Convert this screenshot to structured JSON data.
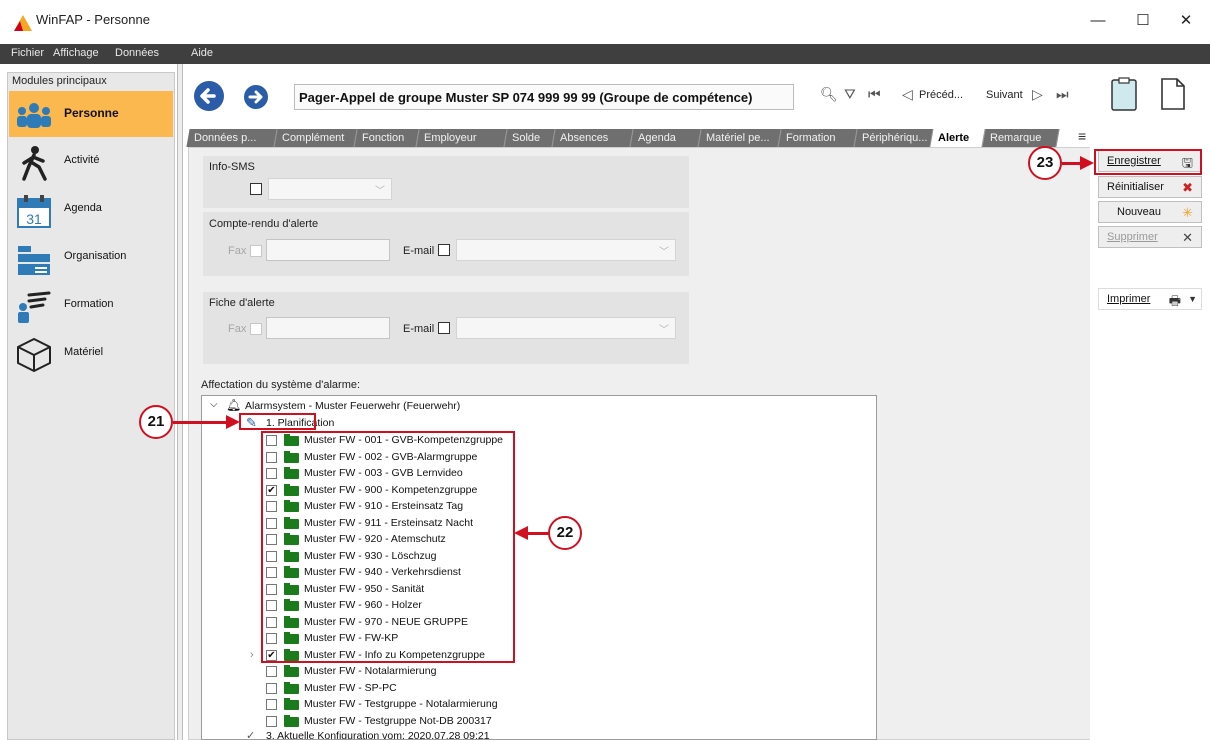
{
  "window": {
    "title": "WinFAP - Personne",
    "min": "—",
    "max": "☐",
    "close": "✕"
  },
  "menu": [
    "Fichier",
    "Affichage",
    "Données",
    "Aide"
  ],
  "sidebar": {
    "title": "Modules principaux",
    "items": [
      {
        "label": "Personne",
        "active": true,
        "icon": "people-icon"
      },
      {
        "label": "Activité",
        "icon": "walking-person-icon"
      },
      {
        "label": "Agenda",
        "icon": "calendar-icon"
      },
      {
        "label": "Organisation",
        "icon": "organization-icon"
      },
      {
        "label": "Formation",
        "icon": "presentation-icon"
      },
      {
        "label": "Matériel",
        "icon": "box-icon"
      }
    ],
    "calendar_day": "31"
  },
  "header": {
    "record_title": "Pager-Appel de groupe Muster SP 074 999 99 99 (Groupe de compétence)",
    "prev_label": "Précéd...",
    "next_label": "Suivant"
  },
  "tabs": [
    "Données p...",
    "Complément",
    "Fonction",
    "Employeur",
    "Solde",
    "Absences",
    "Agenda",
    "Matériel pe...",
    "Formation",
    "Périphériqu...",
    "Alerte",
    "Remarque"
  ],
  "active_tab": "Alerte",
  "form": {
    "info_sms_label": "Info-SMS",
    "compte_rendu_label": "Compte-rendu d'alerte",
    "fiche_label": "Fiche d'alerte",
    "fax_label": "Fax",
    "email_label": "E-mail",
    "affectation_label": "Affectation du système d'alarme:"
  },
  "tree": {
    "root": "Alarmsystem - Muster Feuerwehr (Feuerwehr)",
    "planification": "1. Planification",
    "groups": [
      {
        "label": "Muster FW - 001 - GVB-Kompetenzgruppe",
        "checked": false
      },
      {
        "label": "Muster FW - 002 - GVB-Alarmgruppe",
        "checked": false
      },
      {
        "label": "Muster FW - 003 - GVB Lernvideo",
        "checked": false
      },
      {
        "label": "Muster FW - 900 - Kompetenzgruppe",
        "checked": true
      },
      {
        "label": "Muster FW - 910 - Ersteinsatz Tag",
        "checked": false
      },
      {
        "label": "Muster FW - 911 - Ersteinsatz Nacht",
        "checked": false
      },
      {
        "label": "Muster FW - 920 - Atemschutz",
        "checked": false
      },
      {
        "label": "Muster FW - 930 - Löschzug",
        "checked": false
      },
      {
        "label": "Muster FW - 940 - Verkehrsdienst",
        "checked": false
      },
      {
        "label": "Muster FW - 950 - Sanität",
        "checked": false
      },
      {
        "label": "Muster FW - 960 - Holzer",
        "checked": false
      },
      {
        "label": "Muster FW - 970 - NEUE GRUPPE",
        "checked": false
      },
      {
        "label": "Muster FW - FW-KP",
        "checked": false
      },
      {
        "label": "Muster FW - Info zu Kompetenzgruppe",
        "checked": true
      },
      {
        "label": "Muster FW - Notalarmierung",
        "checked": false
      },
      {
        "label": "Muster FW - SP-PC",
        "checked": false
      },
      {
        "label": "Muster FW - Testgruppe - Notalarmierung",
        "checked": false
      },
      {
        "label": "Muster FW - Testgruppe Not-DB 200317",
        "checked": false
      }
    ],
    "config": "3. Aktuelle Konfiguration vom: 2020.07.28 09:21"
  },
  "actions": {
    "save": "Enregistrer",
    "reset": "Réinitialiser",
    "new": "Nouveau",
    "delete": "Supprimer",
    "print": "Imprimer"
  },
  "callouts": {
    "c21": "21",
    "c22": "22",
    "c23": "23"
  },
  "colors": {
    "accent": "#fbb84e",
    "callout": "#d01020",
    "nav": "#2a5ca8",
    "folder": "#1b7a1b"
  }
}
